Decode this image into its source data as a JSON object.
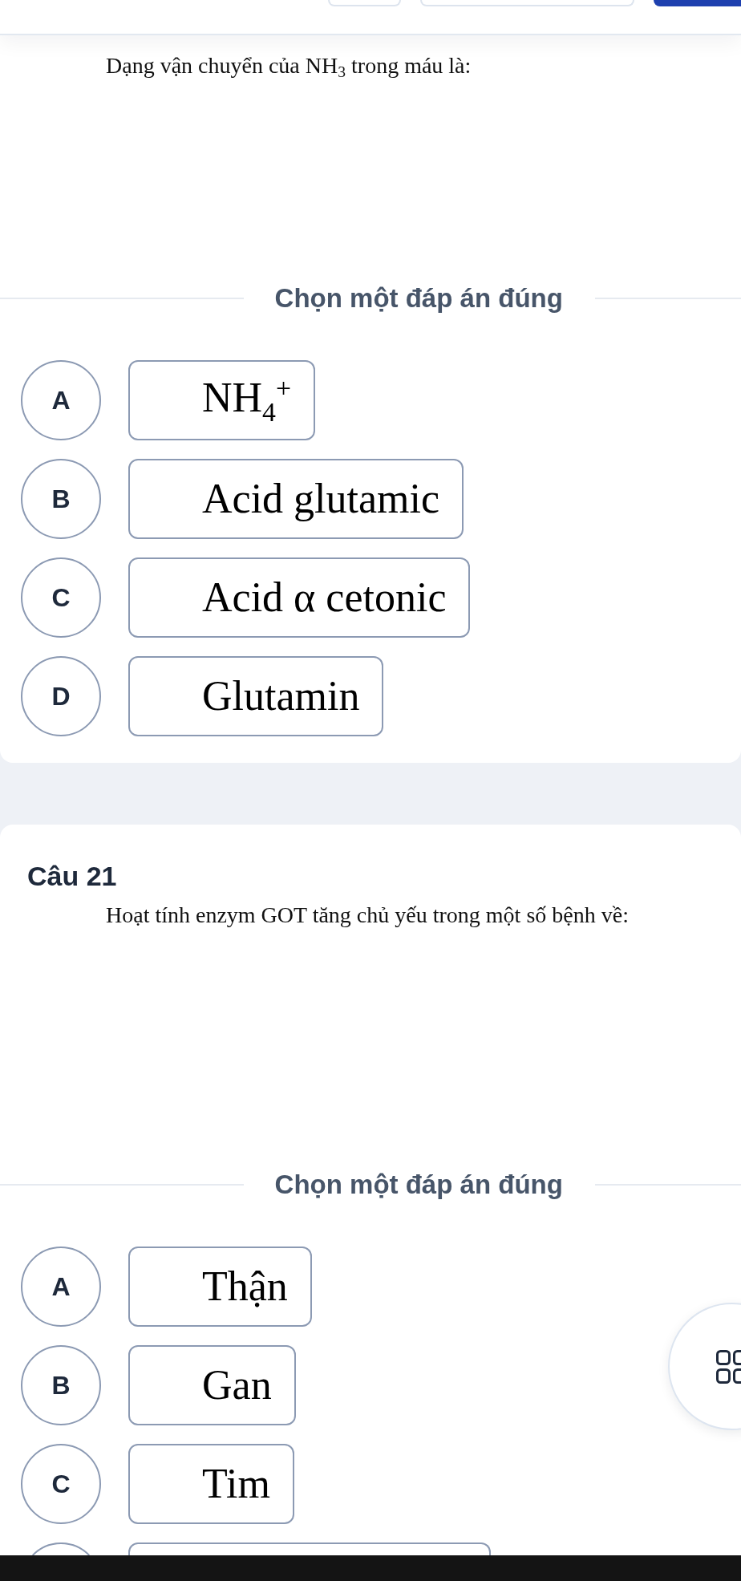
{
  "header": {
    "buttons": [
      {
        "kind": "outline"
      },
      {
        "kind": "outline"
      },
      {
        "kind": "filled"
      }
    ]
  },
  "questions": [
    {
      "question": "Dạng vận chuyển của NH$_{3}$ trong máu là:",
      "instruction": "Chọn một đáp án đúng",
      "options": [
        {
          "letter": "A",
          "text": "NH$_{4}$$^{+}$",
          "selected": false
        },
        {
          "letter": "B",
          "text": "Acid glutamic",
          "selected": false
        },
        {
          "letter": "C",
          "text": "Acid α cetonic",
          "selected": false
        },
        {
          "letter": "D",
          "text": "Glutamin",
          "selected": false
        }
      ],
      "more_options_below": false
    },
    {
      "title": "Câu 21",
      "question": "Hoạt tính enzym GOT tăng chủ yếu trong một số bệnh về:",
      "instruction": "Chọn một đáp án đúng",
      "options": [
        {
          "letter": "A",
          "text": "Thận",
          "selected": false
        },
        {
          "letter": "B",
          "text": "Gan",
          "selected": false
        },
        {
          "letter": "C",
          "text": "Tim",
          "selected": false
        }
      ],
      "more_options_below": true
    }
  ]
}
